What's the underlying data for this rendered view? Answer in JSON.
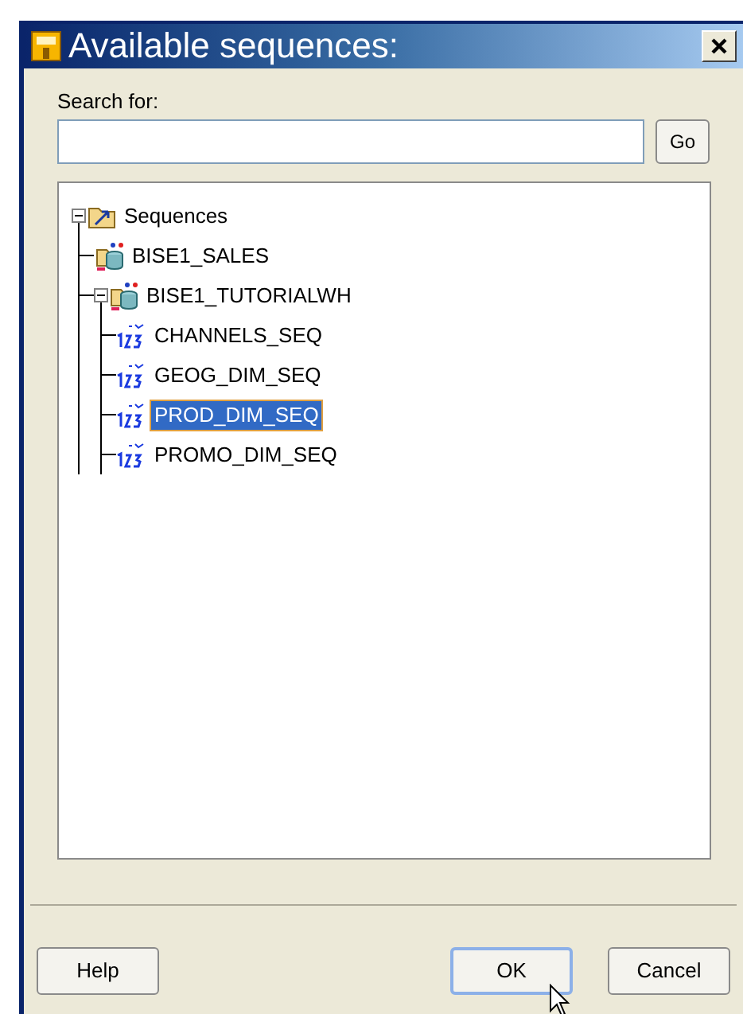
{
  "window": {
    "title": "Available sequences:"
  },
  "search": {
    "label": "Search for:",
    "go_button": "Go"
  },
  "tree": [
    {
      "label": "Sequences",
      "kind": "folder",
      "expanded": true,
      "selected": false,
      "children": [
        {
          "label": "BISE1_SALES",
          "kind": "schema",
          "selected": false
        },
        {
          "label": "BISE1_TUTORIALWH",
          "kind": "schema",
          "expanded": true,
          "selected": false,
          "children": [
            {
              "label": "CHANNELS_SEQ",
              "kind": "sequence",
              "selected": false
            },
            {
              "label": "GEOG_DIM_SEQ",
              "kind": "sequence",
              "selected": false
            },
            {
              "label": "PROD_DIM_SEQ",
              "kind": "sequence",
              "selected": true
            },
            {
              "label": "PROMO_DIM_SEQ",
              "kind": "sequence",
              "selected": false
            }
          ]
        }
      ]
    }
  ],
  "buttons": [
    {
      "label": "Help",
      "default": false
    },
    {
      "label": "OK",
      "default": true
    },
    {
      "label": "Cancel",
      "default": false
    }
  ]
}
